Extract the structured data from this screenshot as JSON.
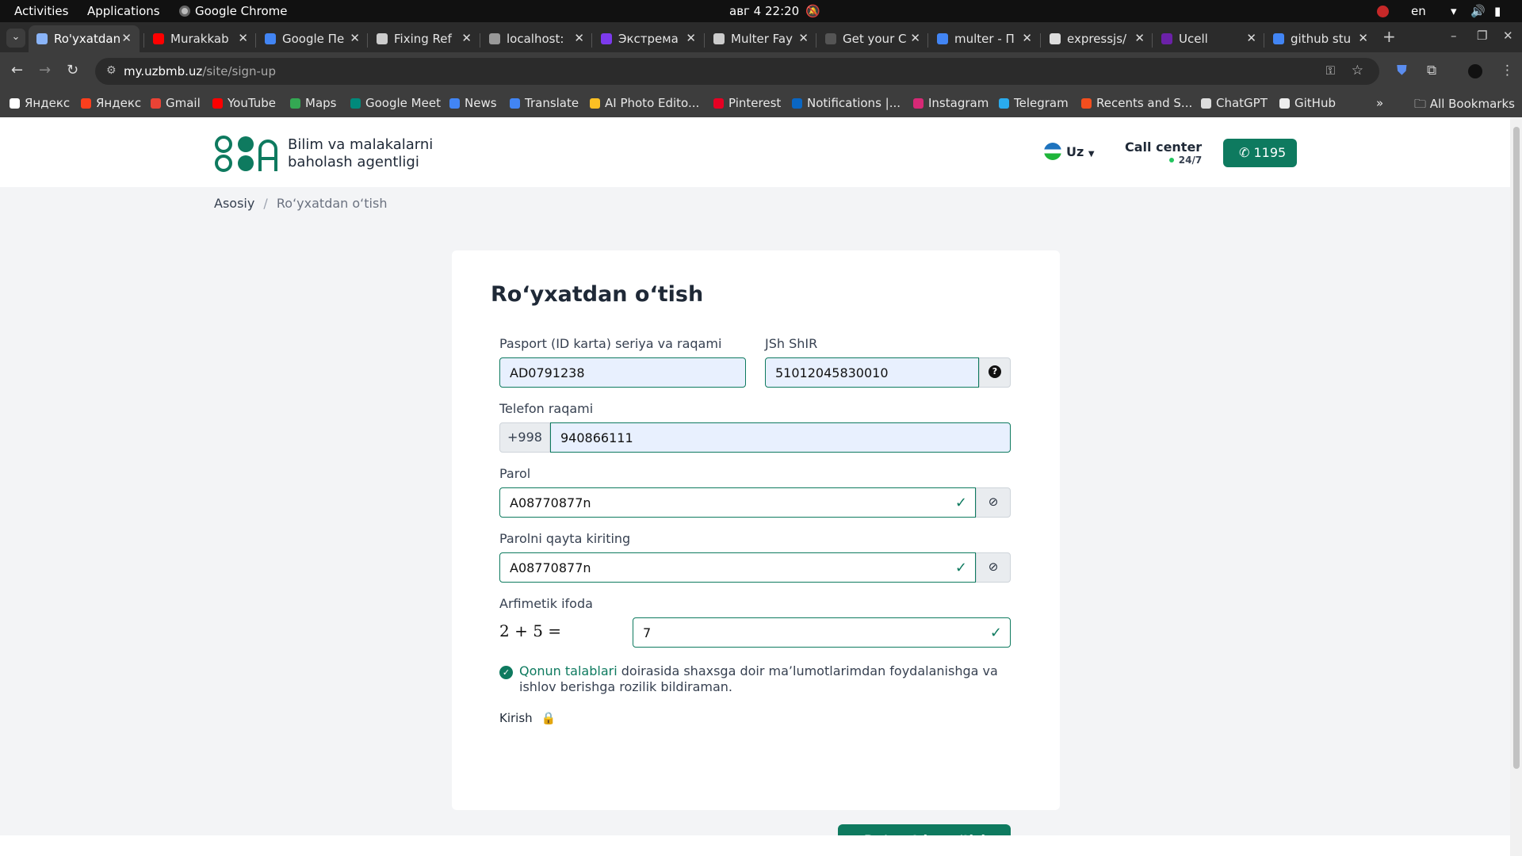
{
  "system": {
    "activities": "Activities",
    "applications": "Applications",
    "app": "Google Chrome",
    "clock": "авг 4  22:20",
    "lang": "en"
  },
  "tabs": [
    {
      "title": "Ro'yxatdan",
      "color": "#8ab4f8"
    },
    {
      "title": "Murakkab",
      "color": "#ff0000"
    },
    {
      "title": "Google Пе",
      "color": "#4285f4"
    },
    {
      "title": "Fixing Ref",
      "color": "#cccccc"
    },
    {
      "title": "localhost:",
      "color": "#999999"
    },
    {
      "title": "Экстрема",
      "color": "#7c3aed"
    },
    {
      "title": "Multer Fay",
      "color": "#cccccc"
    },
    {
      "title": "Get your C",
      "color": "#555555"
    },
    {
      "title": "multer - П",
      "color": "#4285f4"
    },
    {
      "title": "expressjs/",
      "color": "#dddddd"
    },
    {
      "title": "Ucell",
      "color": "#6b21a8"
    },
    {
      "title": "github stu",
      "color": "#4285f4"
    }
  ],
  "address": {
    "host": "my.uzbmb.uz",
    "path": "/site/sign-up"
  },
  "bookmarks": [
    {
      "label": "Яндекс",
      "color": "#ffffff"
    },
    {
      "label": "Яндекс",
      "color": "#fc3f1d"
    },
    {
      "label": "Gmail",
      "color": "#ea4335"
    },
    {
      "label": "YouTube",
      "color": "#ff0000"
    },
    {
      "label": "Maps",
      "color": "#34a853"
    },
    {
      "label": "Google Meet",
      "color": "#00897b"
    },
    {
      "label": "News",
      "color": "#4285f4"
    },
    {
      "label": "Translate",
      "color": "#4285f4"
    },
    {
      "label": "AI Photo Edito...",
      "color": "#fbbf24"
    },
    {
      "label": "Pinterest",
      "color": "#e60023"
    },
    {
      "label": "Notifications |...",
      "color": "#0a66c2"
    },
    {
      "label": "Instagram",
      "color": "#d62976"
    },
    {
      "label": "Telegram",
      "color": "#2aabee"
    },
    {
      "label": "Recents and S...",
      "color": "#f24e1e"
    },
    {
      "label": "ChatGPT",
      "color": "#dddddd"
    },
    {
      "label": "GitHub",
      "color": "#eeeeee"
    }
  ],
  "all_bookmarks": "All Bookmarks",
  "site": {
    "org_line1": "Bilim va malakalarni",
    "org_line2": "baholash agentligi",
    "lang": "Uz",
    "call_center": "Call center",
    "call_hours": "24/7",
    "phone": "1195",
    "brand_color": "#0e7a5f"
  },
  "breadcrumb": {
    "home": "Asosiy",
    "sep": "/",
    "current": "Ro‘yxatdan o‘tish"
  },
  "form": {
    "title": "Ro‘yxatdan o‘tish",
    "passport_label": "Pasport (ID karta) seriya va raqami",
    "passport_value": "AD0791238",
    "pinfl_label": "JSh ShIR",
    "pinfl_value": "51012045830010",
    "phone_label": "Telefon raqami",
    "phone_prefix": "+998",
    "phone_value": "940866111",
    "password_label": "Parol",
    "password_value": "A08770877n",
    "password2_label": "Parolni qayta kiriting",
    "password2_value": "A08770877n",
    "math_label": "Arfimetik ifoda",
    "math_expr": "2 + 5 =",
    "math_value": "7",
    "agree_link": "Qonun talablari",
    "agree_text": " doirasida shaxsga doir ma’lumotlarimdan foydalanishga va ishlov berishga rozilik bildiraman.",
    "login_label": "Kirish",
    "submit_label": "Ro‘yxatdan o‘tish"
  }
}
